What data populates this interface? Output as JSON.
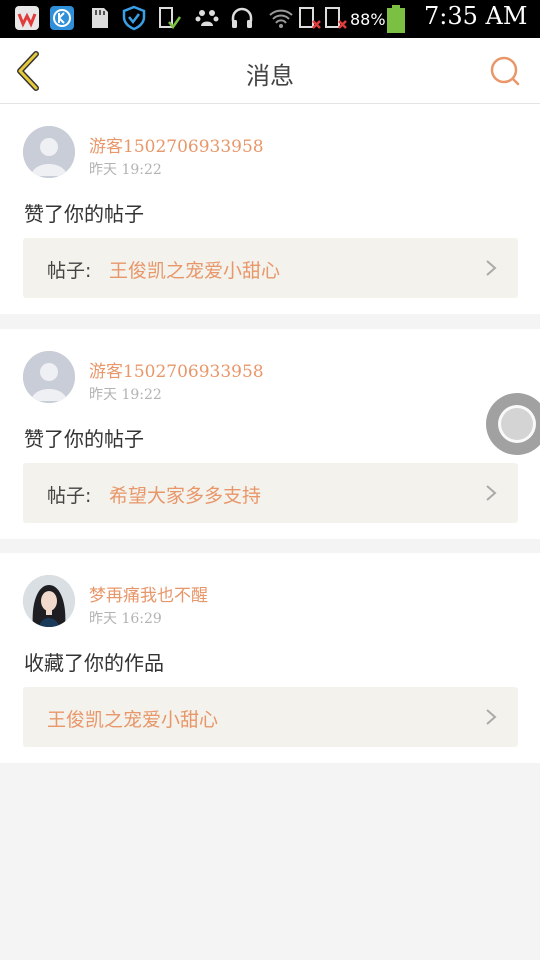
{
  "status_bar": {
    "battery_percent": "88%",
    "time": "7:35 AM",
    "icons": [
      "weibo-icon",
      "k-app-icon",
      "sd-card-icon",
      "shield-icon",
      "download-check-icon",
      "baidu-paw-icon",
      "headset-icon",
      "wifi-icon",
      "sim1-icon",
      "sim2-icon",
      "battery-icon"
    ]
  },
  "header": {
    "title": "消息",
    "back_icon": "chevron-left-icon",
    "search_icon": "search-icon"
  },
  "colors": {
    "accent": "#e8976a",
    "back_yellow": "#e7c93c",
    "background": "#f4f4f4",
    "link_bg": "#f3f2ec"
  },
  "messages": [
    {
      "username": "游客1502706933958",
      "time": "昨天 19:22",
      "action": "赞了你的帖子",
      "post_prefix": "帖子:",
      "post_title": "王俊凯之宠爱小甜心",
      "avatar": "default-avatar"
    },
    {
      "username": "游客1502706933958",
      "time": "昨天 19:22",
      "action": "赞了你的帖子",
      "post_prefix": "帖子:",
      "post_title": "希望大家多多支持",
      "avatar": "default-avatar"
    },
    {
      "username": "梦再痛我也不醒",
      "time": "昨天 16:29",
      "action": "收藏了你的作品",
      "post_prefix": "",
      "post_title": "王俊凯之宠爱小甜心",
      "avatar": "photo-avatar"
    }
  ]
}
